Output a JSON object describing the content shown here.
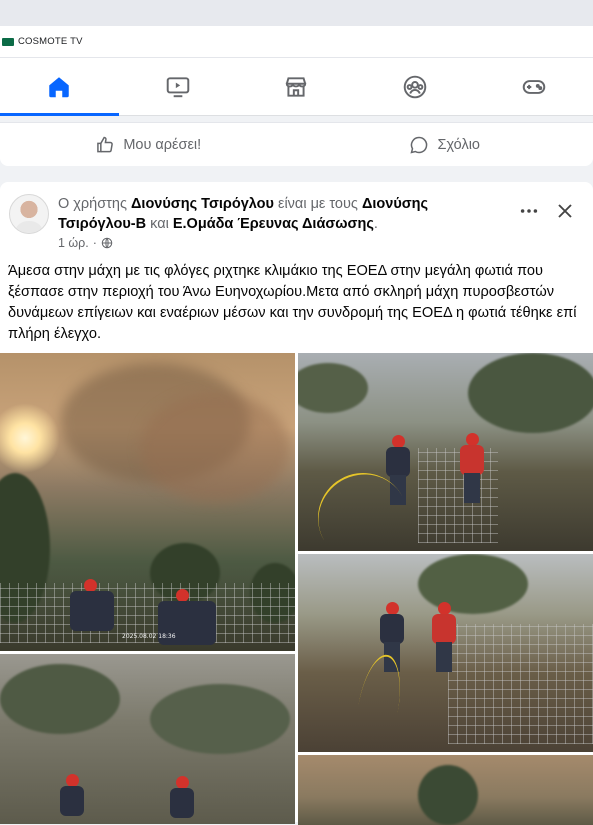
{
  "banner": {
    "label": "COSMOTE TV"
  },
  "colors": {
    "accent": "#0866ff",
    "text": "#050505",
    "muted": "#65676b",
    "surface": "#ffffff",
    "background": "#f0f2f5"
  },
  "nav": {
    "items": [
      {
        "icon": "home-icon",
        "active": true
      },
      {
        "icon": "video-icon",
        "active": false
      },
      {
        "icon": "marketplace-icon",
        "active": false
      },
      {
        "icon": "groups-icon",
        "active": false
      },
      {
        "icon": "gaming-icon",
        "active": false
      }
    ]
  },
  "actions": {
    "like_label": "Μου αρέσει!",
    "comment_label": "Σχόλιο"
  },
  "post": {
    "prefix": "Ο χρήστης ",
    "author": "Διονύσης Τσιρόγλου",
    "with_text": " είναι με τους ",
    "tagged_1": "Διονύσης Τσιρόγλου-Β",
    "and_text": " και ",
    "tagged_2": "Ε.Ομάδα Έρευνας Διάσωσης",
    "period": ".",
    "time": "1 ώρ.",
    "separator": " · ",
    "privacy_icon": "globe-icon",
    "body": "Άμεσα στην μάχη με τις φλόγες ριχτηκε κλιμάκιο της ΕΟΕΔ στην μεγάλη φωτιά που ξέσπασε στην περιοχή του Άνω Ευηνοχωρίου.Μετα από σκληρή μάχη πυροσβεστών δυνάμεων επίγειων και εναέριων μέσων και την συνδρομή της ΕΟΕΔ η φωτιά τέθηκε επί πλήρη έλεγχο.",
    "photo_timestamp": "2025.08.02 18:36"
  }
}
